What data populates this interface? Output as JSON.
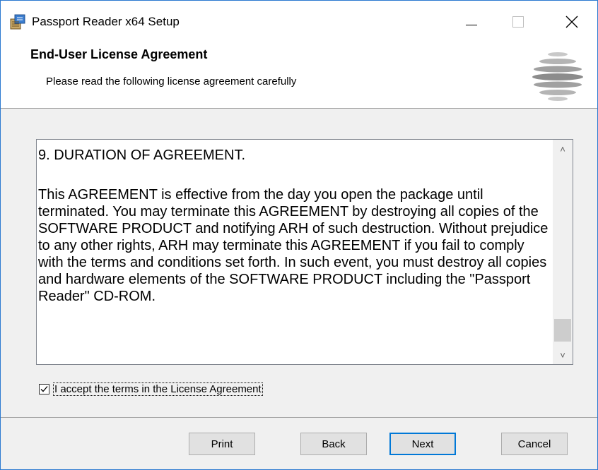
{
  "window": {
    "title": "Passport Reader x64 Setup",
    "controls": {
      "minimize": "—",
      "maximize": "□",
      "close": "✕"
    }
  },
  "header": {
    "title": "End-User License Agreement",
    "subtitle": "Please read the following license agreement carefully"
  },
  "license": {
    "heading": "9. DURATION OF AGREEMENT.",
    "body": "This AGREEMENT is effective from the day you open the package until terminated. You may terminate this AGREEMENT by destroying all copies of the SOFTWARE PRODUCT and notifying ARH of such destruction. Without prejudice to any other rights, ARH may terminate this AGREEMENT if you fail to comply with the terms and conditions set forth. In such event, you must destroy all copies and hardware elements of the SOFTWARE PRODUCT including the \"Passport Reader\" CD-ROM.",
    "scroll_up": "˄",
    "scroll_down": "˅"
  },
  "accept": {
    "label": "I accept the terms in the License Agreement",
    "checked": true
  },
  "buttons": {
    "print": "Print",
    "back": "Back",
    "next": "Next",
    "cancel": "Cancel"
  },
  "colors": {
    "accent": "#0078d7",
    "window_border": "#2b79d0"
  }
}
